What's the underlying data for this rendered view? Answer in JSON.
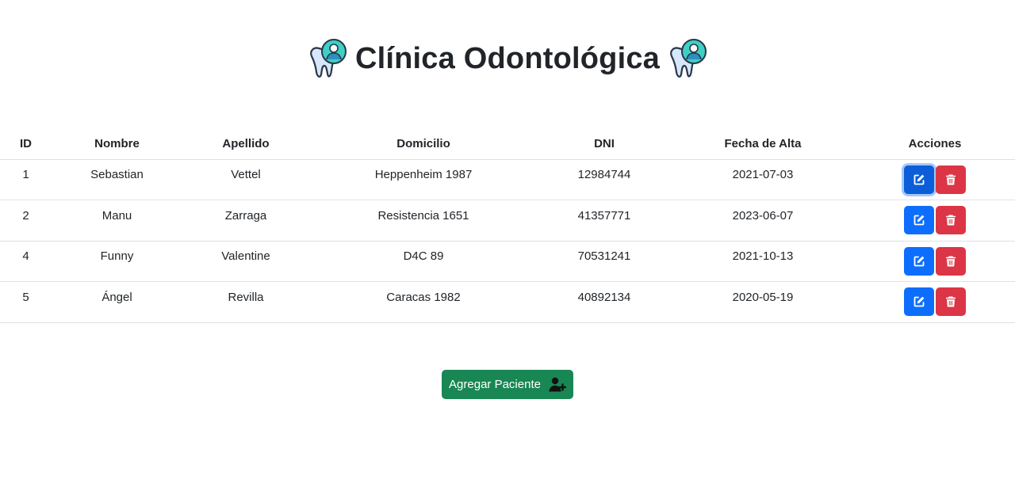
{
  "page": {
    "title": "Clínica Odontológica"
  },
  "table": {
    "headers": {
      "id": "ID",
      "nombre": "Nombre",
      "apellido": "Apellido",
      "domicilio": "Domicilio",
      "dni": "DNI",
      "fecha": "Fecha de Alta",
      "acciones": "Acciones"
    },
    "rows": [
      {
        "id": "1",
        "nombre": "Sebastian",
        "apellido": "Vettel",
        "domicilio": "Heppenheim 1987",
        "dni": "12984744",
        "fecha": "2021-07-03"
      },
      {
        "id": "2",
        "nombre": "Manu",
        "apellido": "Zarraga",
        "domicilio": "Resistencia 1651",
        "dni": "41357771",
        "fecha": "2023-06-07"
      },
      {
        "id": "4",
        "nombre": "Funny",
        "apellido": "Valentine",
        "domicilio": "D4C 89",
        "dni": "70531241",
        "fecha": "2021-10-13"
      },
      {
        "id": "5",
        "nombre": "Ángel",
        "apellido": "Revilla",
        "domicilio": "Caracas 1982",
        "dni": "40892134",
        "fecha": "2020-05-19"
      }
    ]
  },
  "actions": {
    "edit_icon": "pen-to-square-icon",
    "delete_icon": "trash-icon",
    "add_label": "Agregar Paciente",
    "add_icon": "user-plus-icon"
  },
  "colors": {
    "edit": "#0d6efd",
    "delete": "#dc3545",
    "add": "#198754"
  }
}
